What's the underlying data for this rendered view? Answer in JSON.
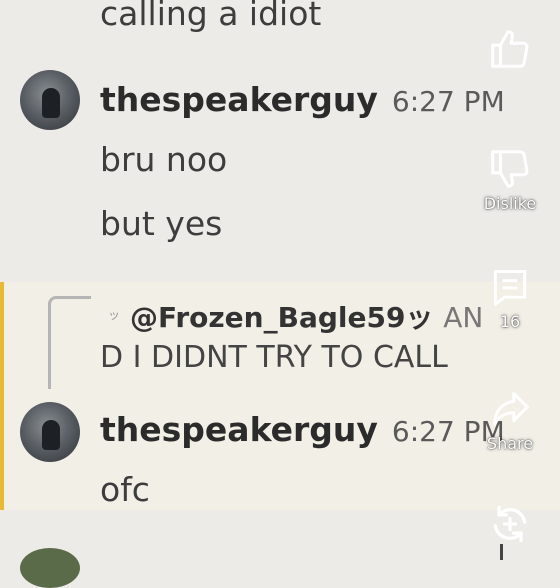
{
  "messages": {
    "top_fragment": "calling a idiot",
    "first": {
      "username": "thespeakerguy",
      "time": "6:27 PM",
      "lines": [
        "bru noo",
        "but yes"
      ]
    },
    "reply": {
      "mention": "@Frozen_Bagle59ッ",
      "tail": "AN",
      "continuation": "D I DIDNT TRY TO CALL"
    },
    "second": {
      "username": "thespeakerguy",
      "time": "6:27 PM",
      "lines": [
        "ofc"
      ]
    }
  },
  "actions": {
    "like": {
      "icon": "thumbs-up-icon"
    },
    "dislike": {
      "icon": "thumbs-down-icon",
      "label": "Dislike"
    },
    "comments": {
      "icon": "comment-icon",
      "count": "16"
    },
    "share": {
      "icon": "share-icon",
      "label": "Share"
    },
    "remix": {
      "icon": "remix-icon"
    }
  },
  "colors": {
    "highlight": "#e8b931",
    "background": "#ecebe8"
  }
}
